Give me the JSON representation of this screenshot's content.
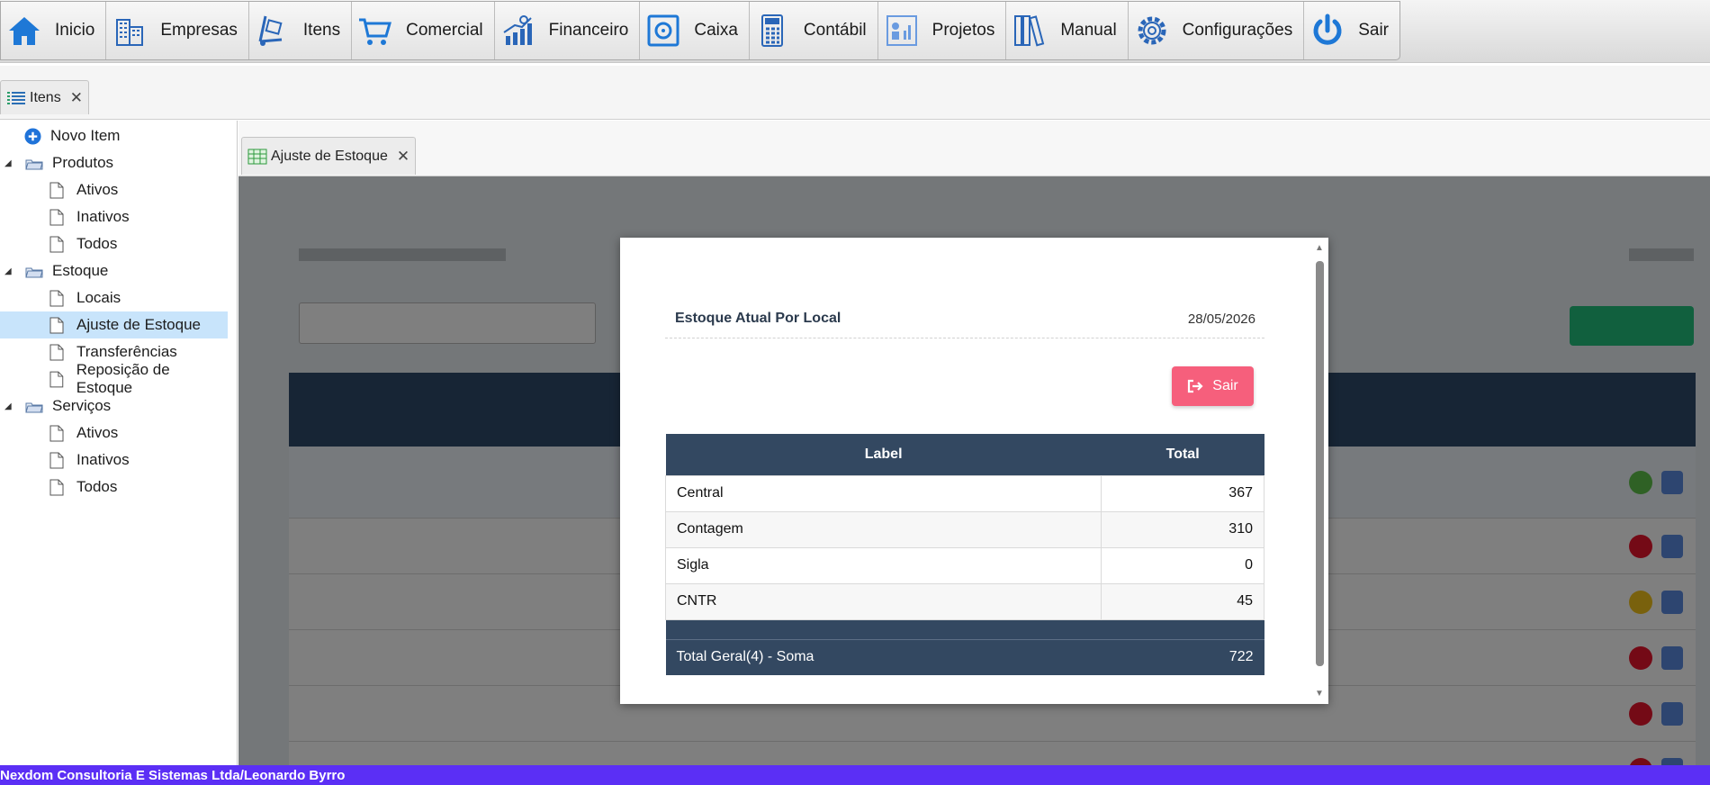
{
  "menu": {
    "items": [
      {
        "label": "Inicio",
        "icon": "home-icon"
      },
      {
        "label": "Empresas",
        "icon": "buildings-icon"
      },
      {
        "label": "Itens",
        "icon": "hand-truck-icon"
      },
      {
        "label": "Comercial",
        "icon": "cart-icon"
      },
      {
        "label": "Financeiro",
        "icon": "growth-chart-icon"
      },
      {
        "label": "Caixa",
        "icon": "safe-icon"
      },
      {
        "label": "Contábil",
        "icon": "calculator-icon"
      },
      {
        "label": "Projetos",
        "icon": "project-board-icon"
      },
      {
        "label": "Manual",
        "icon": "binders-icon"
      },
      {
        "label": "Configurações",
        "icon": "gear-icon"
      },
      {
        "label": "Sair",
        "icon": "power-icon"
      }
    ]
  },
  "outer_tab": {
    "label": "Itens"
  },
  "sidebar": {
    "new_item": "Novo Item",
    "groups": [
      {
        "label": "Produtos",
        "children": [
          "Ativos",
          "Inativos",
          "Todos"
        ]
      },
      {
        "label": "Estoque",
        "children": [
          "Locais",
          "Ajuste de Estoque",
          "Transferências",
          "Reposição de Estoque"
        ]
      },
      {
        "label": "Serviços",
        "children": [
          "Ativos",
          "Inativos",
          "Todos"
        ]
      }
    ],
    "selected": "Ajuste de Estoque"
  },
  "inner_tab": {
    "label": "Ajuste de Estoque"
  },
  "modal": {
    "title": "Estoque Atual Por Local",
    "date": "28/05/2026",
    "exit_button": "Sair",
    "table": {
      "headers": [
        "Label",
        "Total"
      ],
      "rows": [
        {
          "label": "Central",
          "total": "367"
        },
        {
          "label": "Contagem",
          "total": "310"
        },
        {
          "label": "Sigla",
          "total": "0"
        },
        {
          "label": "CNTR",
          "total": "45"
        }
      ],
      "footer_label": "Total Geral(4) - Soma",
      "footer_total": "722"
    }
  },
  "footer": {
    "text": "Nexdom Consultoria E Sistemas Ltda/Leonardo Byrro"
  },
  "colors": {
    "accent": "#334861",
    "exit": "#f65f7c",
    "footer": "#5b2ff5",
    "selected": "#c8e4fb"
  }
}
